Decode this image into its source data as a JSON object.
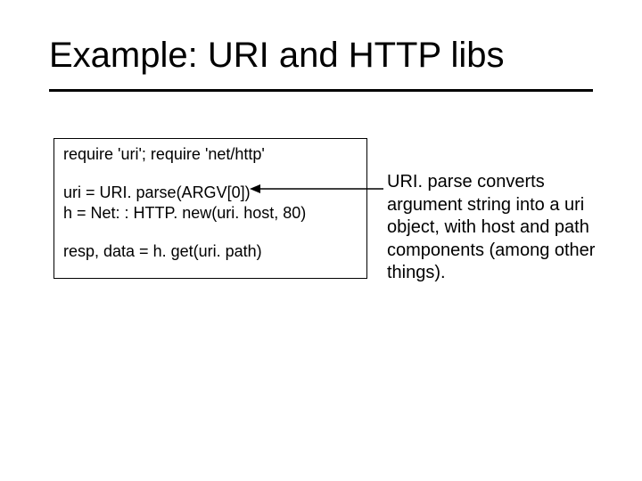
{
  "title": "Example: URI and HTTP libs",
  "code": {
    "l1": "require 'uri'; require  'net/http'",
    "l2a": "uri = ",
    "l2b": "URI. parse",
    "l2c": "(ARGV[0])",
    "l3": "h = Net: : HTTP. new(uri. host, 80)",
    "l4": "resp, data = h. get(uri. path)"
  },
  "explain": {
    "e1a": "URI. parse ",
    "e1b": "converts argument string into a uri object, with ",
    "e1c": "host ",
    "e1d": "and ",
    "e1e": "path ",
    "e1f": "components (among other things)."
  }
}
